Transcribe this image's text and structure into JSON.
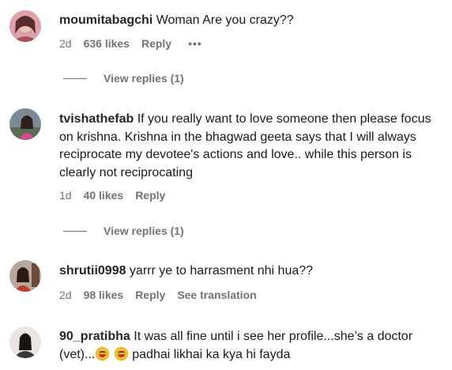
{
  "comments": [
    {
      "username": "moumitabagchi",
      "text": " Woman Are you crazy??",
      "time": "2d",
      "likes": "636 likes",
      "reply": "Reply",
      "more": "•••",
      "view_replies": "View replies (1)"
    },
    {
      "username": "tvishathefab",
      "text": " If you really want to love someone then please focus on krishna. Krishna in the bhagwad geeta says that I will always reciprocate my devotee's actions and love.. while this person is clearly not reciprocating",
      "time": "1d",
      "likes": "40 likes",
      "reply": "Reply",
      "view_replies": "View replies (1)"
    },
    {
      "username": "shrutii0998",
      "text": " yarrr ye to harrasment nhi hua??",
      "time": "2d",
      "likes": "98 likes",
      "reply": "Reply",
      "see_translation": "See translation"
    },
    {
      "username": "90_pratibha",
      "text_a": " It was all fine until i see her profile...she’s a doctor (vet)...",
      "text_b": " padhai likhai ka kya hi fayda",
      "emoji": "laughing-face-emoji"
    }
  ]
}
